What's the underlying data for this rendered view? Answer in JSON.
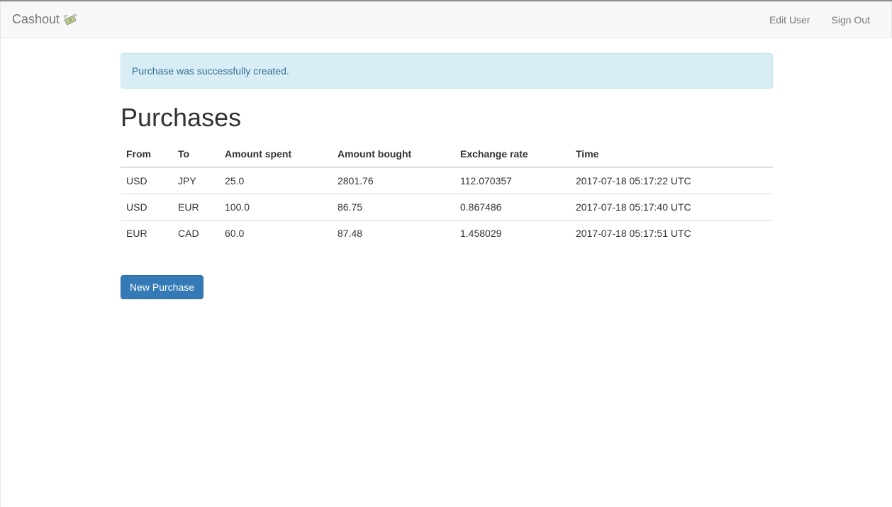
{
  "navbar": {
    "brand": "Cashout",
    "brand_icon": "money-with-wings-icon",
    "links": [
      {
        "label": "Edit User"
      },
      {
        "label": "Sign Out"
      }
    ]
  },
  "alert": {
    "message": "Purchase was successfully created."
  },
  "page": {
    "title": "Purchases"
  },
  "table": {
    "headers": [
      "From",
      "To",
      "Amount spent",
      "Amount bought",
      "Exchange rate",
      "Time"
    ],
    "rows": [
      [
        "USD",
        "JPY",
        "25.0",
        "2801.76",
        "112.070357",
        "2017-07-18 05:17:22 UTC"
      ],
      [
        "USD",
        "EUR",
        "100.0",
        "86.75",
        "0.867486",
        "2017-07-18 05:17:40 UTC"
      ],
      [
        "EUR",
        "CAD",
        "60.0",
        "87.48",
        "1.458029",
        "2017-07-18 05:17:51 UTC"
      ]
    ]
  },
  "actions": {
    "new_purchase": "New Purchase"
  },
  "colors": {
    "primary": "#337ab7",
    "alert_bg": "#d9edf7",
    "alert_text": "#31708f",
    "navbar_bg": "#f8f8f8"
  }
}
